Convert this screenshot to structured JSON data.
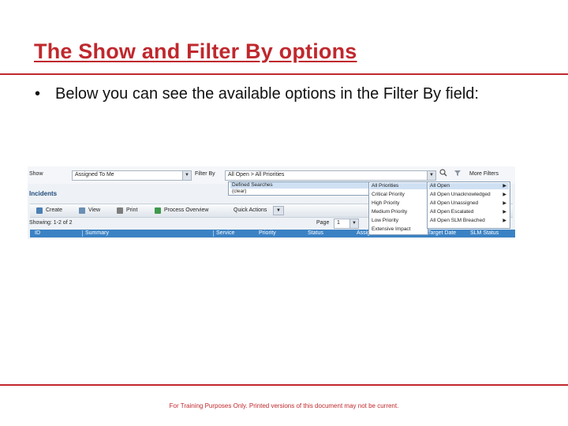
{
  "slide": {
    "title": "The Show and Filter By options",
    "bullet_marker": "•",
    "bullet_text": "Below you can see the available options in the Filter By field:",
    "footer": "For Training Purposes Only. Printed versions of this document may not be current."
  },
  "ui": {
    "show_label": "Show",
    "show_value": "Assigned To Me",
    "filter_by_label": "Filter By",
    "filter_by_value": "All Open > All Priorities",
    "more_filters": "More Filters",
    "incidents_label": "Incidents",
    "toolbar": {
      "create": "Create",
      "view": "View",
      "print": "Print",
      "process_overview": "Process Overview",
      "quick_actions": "Quick Actions"
    },
    "showing": "Showing: 1-2 of 2",
    "page_label": "Page",
    "page_value": "1",
    "columns": [
      "ID",
      "Summary",
      "Service",
      "Priority",
      "Status",
      "Assignee",
      "Target Date",
      "SLM Status"
    ],
    "dropdown_filter": [
      "Defined Searches",
      "(clear)"
    ],
    "dropdown_priority": [
      "All Priorities",
      "Critical Priority",
      "High Priority",
      "Medium Priority",
      "Low Priority",
      "Extensive Impact"
    ],
    "dropdown_open": [
      {
        "label": "All Open",
        "arrow": "▶"
      },
      {
        "label": "All Open Unacknowledged",
        "arrow": "▶"
      },
      {
        "label": "All Open Unassigned",
        "arrow": "▶"
      },
      {
        "label": "All Open Escalated",
        "arrow": "▶"
      },
      {
        "label": "All Open SLM Breached",
        "arrow": "▶"
      }
    ]
  }
}
